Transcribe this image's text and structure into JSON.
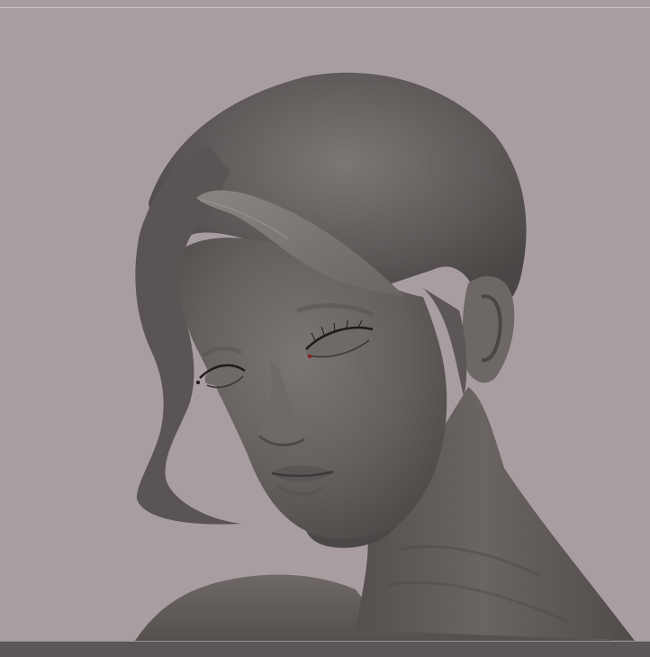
{
  "scene": {
    "subject": "sculpt-bust",
    "colors": {
      "background": "#a89ea1",
      "clay_light": "#77716f",
      "clay_mid": "#5f5a59",
      "clay_dark": "#3d3938",
      "eyelash": "#1e1b1b",
      "eye_accent": "#8a1a1a",
      "bottom_strip": "#5b5657"
    }
  }
}
